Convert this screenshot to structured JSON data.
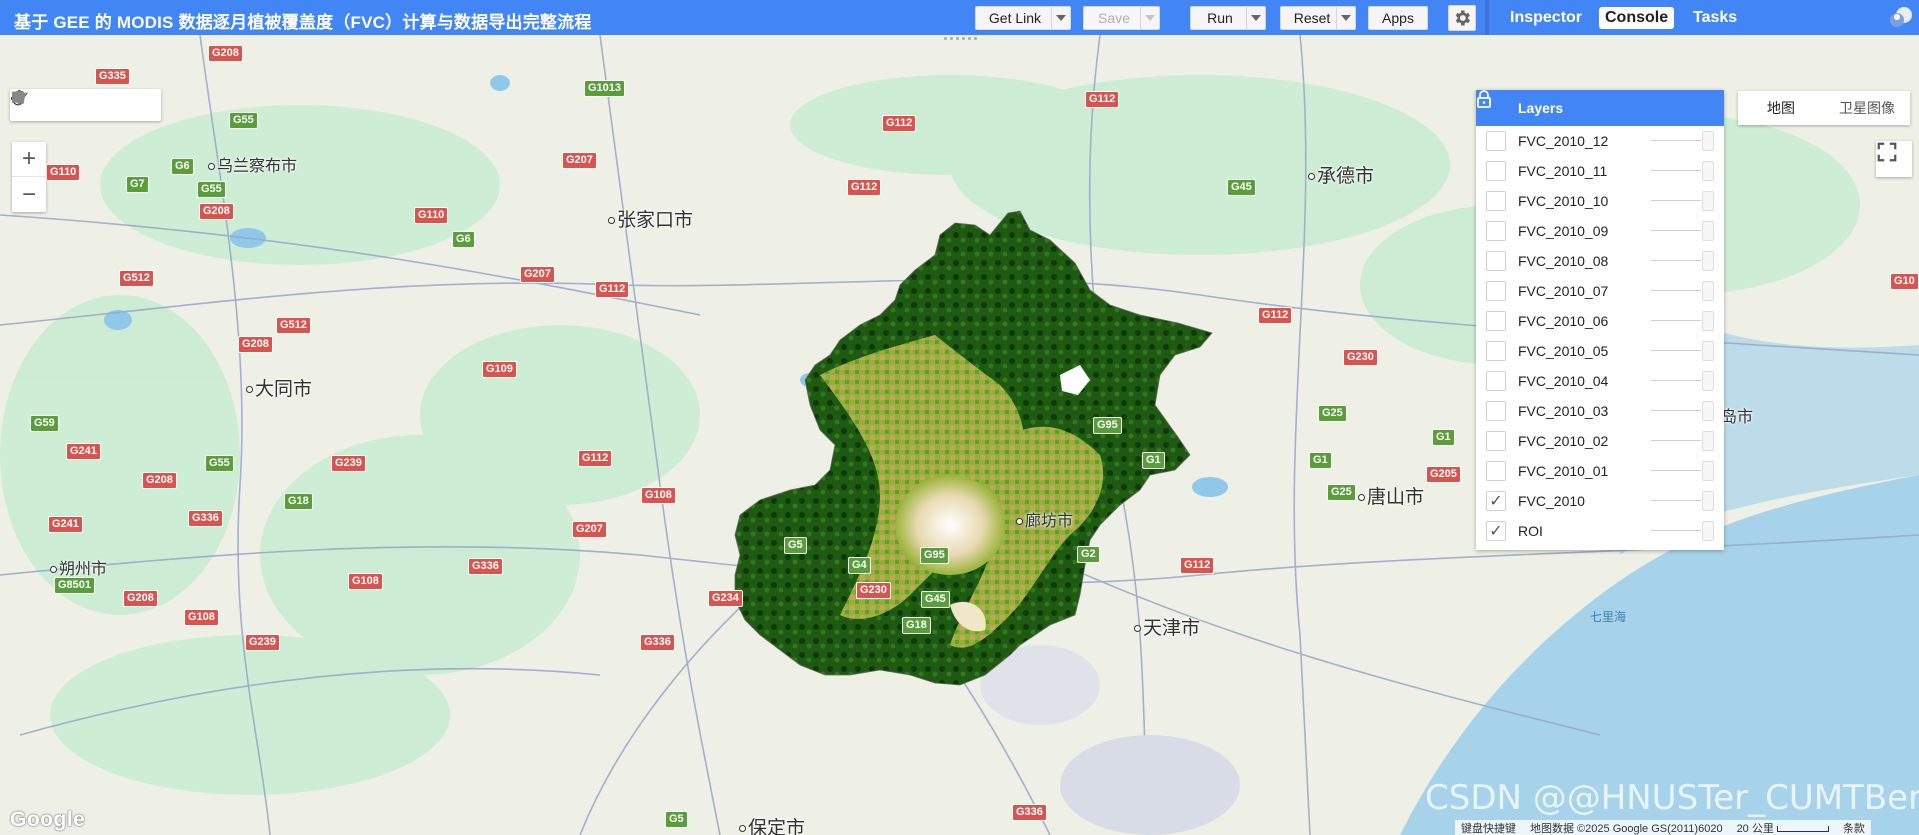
{
  "header": {
    "title": "基于 GEE 的 MODIS 数据逐月植被覆盖度（FVC）计算与数据导出完整流程",
    "buttons": {
      "get_link": "Get Link",
      "save": "Save",
      "run": "Run",
      "reset": "Reset",
      "apps": "Apps"
    },
    "tabs": [
      "Inspector",
      "Console",
      "Tasks"
    ],
    "active_tab": "Console"
  },
  "layers_panel": {
    "title": "Layers",
    "layers": [
      {
        "name": "FVC_2010_12",
        "checked": false
      },
      {
        "name": "FVC_2010_11",
        "checked": false
      },
      {
        "name": "FVC_2010_10",
        "checked": false
      },
      {
        "name": "FVC_2010_09",
        "checked": false
      },
      {
        "name": "FVC_2010_08",
        "checked": false
      },
      {
        "name": "FVC_2010_07",
        "checked": false
      },
      {
        "name": "FVC_2010_06",
        "checked": false
      },
      {
        "name": "FVC_2010_05",
        "checked": false
      },
      {
        "name": "FVC_2010_04",
        "checked": false
      },
      {
        "name": "FVC_2010_03",
        "checked": false
      },
      {
        "name": "FVC_2010_02",
        "checked": false
      },
      {
        "name": "FVC_2010_01",
        "checked": false
      },
      {
        "name": "FVC_2010",
        "checked": true
      },
      {
        "name": "ROI",
        "checked": true
      }
    ]
  },
  "map_type": {
    "map": "地图",
    "satellite": "卫星图像"
  },
  "map": {
    "places": [
      "乌兰察布市",
      "张家口市",
      "承德市",
      "大同市",
      "唐山市",
      "廊坊市",
      "朔州市",
      "天津市",
      "保定市",
      "秦皇岛市"
    ],
    "sea_label": "七里海",
    "highway_shields": [
      "G208",
      "G335",
      "G1013",
      "G55",
      "G6",
      "G110",
      "G7",
      "G55",
      "G208",
      "G110",
      "G207",
      "G6",
      "G112",
      "G112",
      "G112",
      "G45",
      "G512",
      "G207",
      "G112",
      "G512",
      "G208",
      "G109",
      "G112",
      "G230",
      "G59",
      "G241",
      "G55",
      "G239",
      "G208",
      "G18",
      "G336",
      "G241",
      "G112",
      "G108",
      "G207",
      "G95",
      "G1",
      "G1",
      "G25",
      "G1",
      "G205",
      "G25",
      "G5",
      "G4",
      "G95",
      "G2",
      "G112",
      "G336",
      "G108",
      "G208",
      "G234",
      "G230",
      "G45",
      "G108",
      "G239",
      "G336",
      "G18",
      "G5",
      "G336",
      "G8501",
      "G10"
    ]
  },
  "footer": {
    "google": "Google",
    "keyboard": "键盘快捷键",
    "map_data": "地图数据 ©2025 Google GS(2011)6020",
    "scale": "20 公里",
    "terms": "条款",
    "watermark": "CSDN @@HNUSTer_CUMTBer"
  },
  "colors": {
    "topbar": "#4285f4",
    "fvc_high": "#0b3d0b",
    "fvc_mid": "#6b9e1f",
    "fvc_low": "#d9a86c"
  }
}
